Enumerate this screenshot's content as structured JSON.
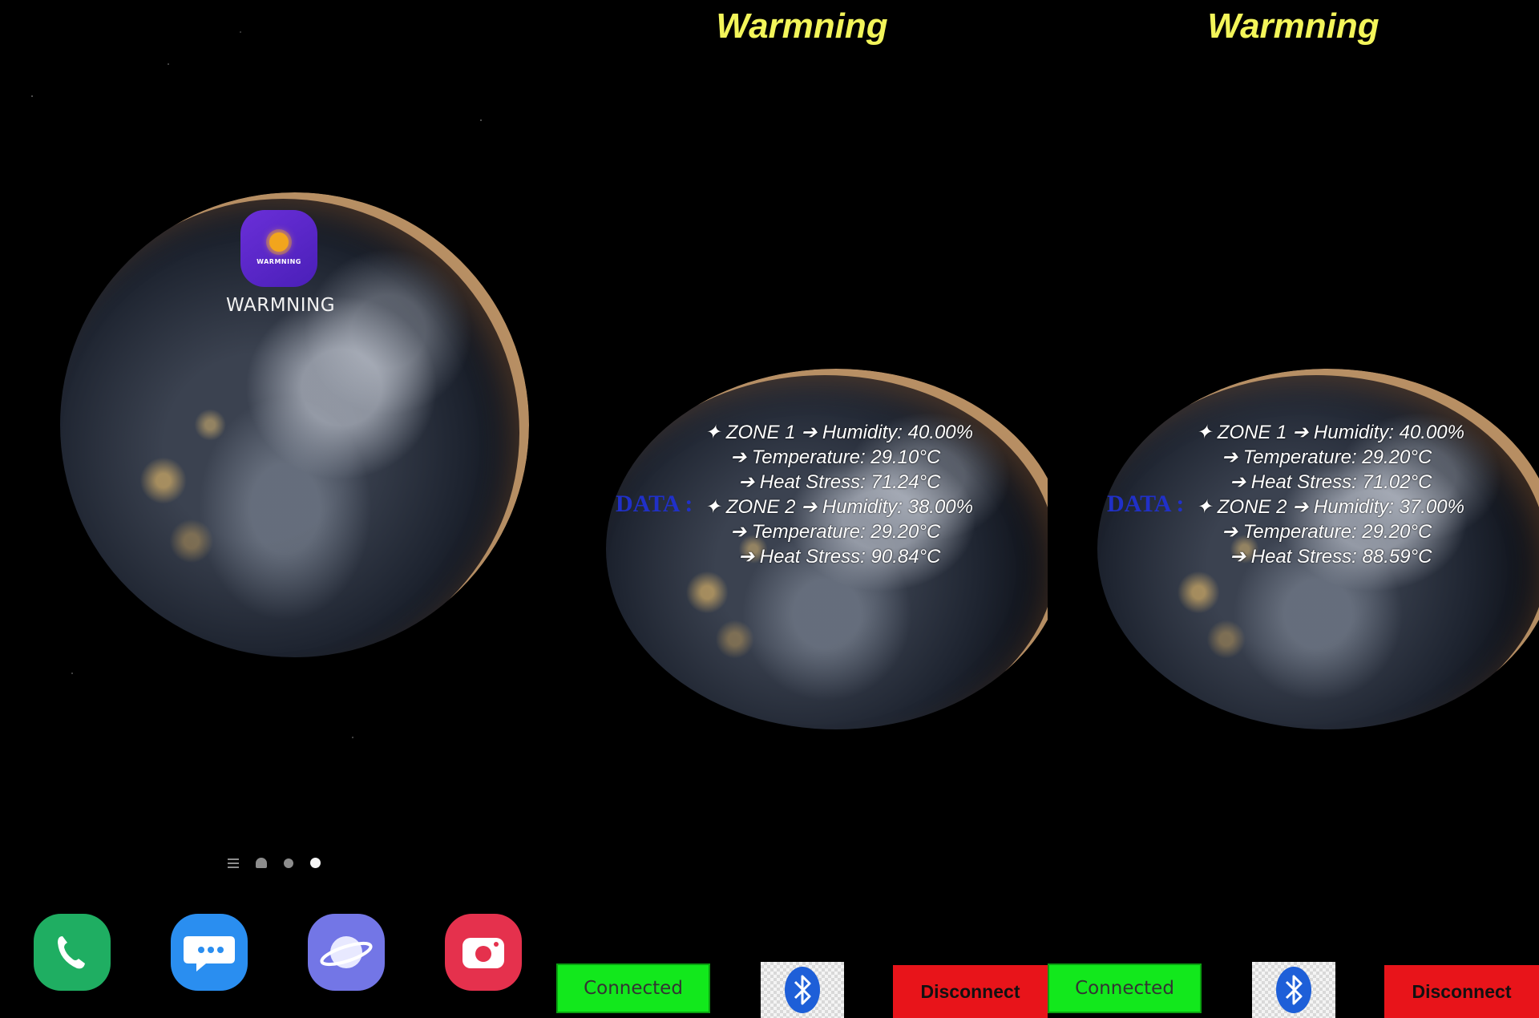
{
  "home_screen": {
    "app": {
      "label": "WARMNING",
      "icon_text": "WARMNING",
      "icon": "sun-icon"
    },
    "page_indicator": {
      "items": [
        "menu",
        "home",
        "page",
        "page-active"
      ]
    },
    "dock": [
      {
        "name": "phone-icon",
        "color": "#1fae62"
      },
      {
        "name": "messages-icon",
        "color": "#2a8ef0"
      },
      {
        "name": "internet-icon",
        "color": "#7376e6"
      },
      {
        "name": "camera-icon",
        "color": "#e5314d"
      }
    ]
  },
  "app_screens": [
    {
      "title": "Warmning",
      "data_label": "DATA :",
      "lines": [
        "✦ ZONE 1 ➔ Humidity: 40.00%",
        "➔ Temperature: 29.10°C",
        "➔ Heat Stress: 71.24°C",
        "✦ ZONE 2 ➔ Humidity: 38.00%",
        "➔ Temperature: 29.20°C",
        "➔ Heat Stress: 90.84°C"
      ],
      "connected_label": "Connected",
      "disconnect_label": "Disconnect",
      "bluetooth_icon": "bluetooth-icon"
    },
    {
      "title": "Warmning",
      "data_label": "DATA :",
      "lines": [
        "✦ ZONE 1 ➔ Humidity: 40.00%",
        "➔ Temperature: 29.20°C",
        "➔ Heat Stress: 71.02°C",
        "✦ ZONE 2 ➔ Humidity: 37.00%",
        "➔ Temperature: 29.20°C",
        "➔ Heat Stress: 88.59°C"
      ],
      "connected_label": "Connected",
      "disconnect_label": "Disconnect",
      "bluetooth_icon": "bluetooth-icon"
    }
  ],
  "colors": {
    "title": "#f3f55a",
    "data_label": "#2030c8",
    "connected": "#12e81c",
    "disconnect": "#e8141a",
    "bluetooth": "#1e5fd8"
  }
}
